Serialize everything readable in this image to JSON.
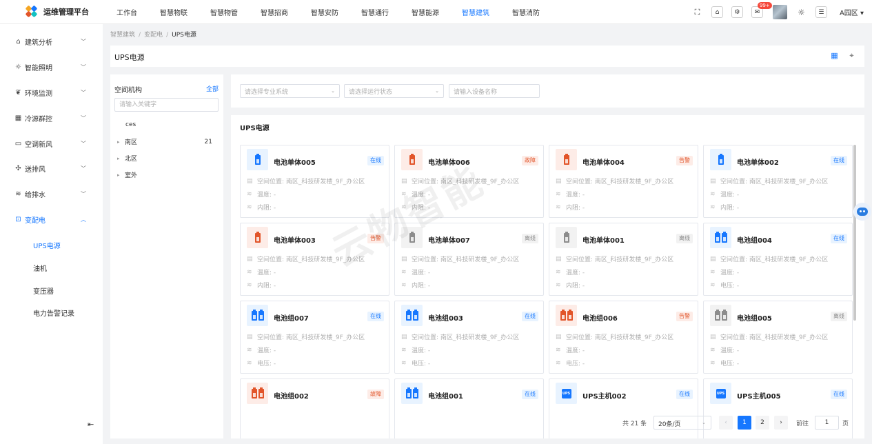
{
  "app": {
    "title": "运维管理平台"
  },
  "topnav": [
    {
      "label": "工作台",
      "active": false
    },
    {
      "label": "智慧物联",
      "active": false
    },
    {
      "label": "智慧物管",
      "active": false
    },
    {
      "label": "智慧招商",
      "active": false
    },
    {
      "label": "智慧安防",
      "active": false
    },
    {
      "label": "智慧通行",
      "active": false
    },
    {
      "label": "智慧能源",
      "active": false
    },
    {
      "label": "智慧建筑",
      "active": true
    },
    {
      "label": "智慧消防",
      "active": false
    }
  ],
  "topbar": {
    "badge": "99+",
    "user": "A园区"
  },
  "sidebar": {
    "items": [
      {
        "label": "建筑分析",
        "icon": "building-icon",
        "glyph": "⌂"
      },
      {
        "label": "智能照明",
        "icon": "lamp-icon",
        "glyph": "☼"
      },
      {
        "label": "环境监测",
        "icon": "leaf-icon",
        "glyph": "❦"
      },
      {
        "label": "冷源群控",
        "icon": "grid-icon",
        "glyph": "▦"
      },
      {
        "label": "空调新风",
        "icon": "aircon-icon",
        "glyph": "▭"
      },
      {
        "label": "送排风",
        "icon": "fan-icon",
        "glyph": "✣"
      },
      {
        "label": "给排水",
        "icon": "water-icon",
        "glyph": "≋"
      },
      {
        "label": "变配电",
        "icon": "power-icon",
        "glyph": "⊡",
        "open": true
      }
    ],
    "sub_items": [
      {
        "label": "UPS电源",
        "active": true
      },
      {
        "label": "油机",
        "active": false
      },
      {
        "label": "变压器",
        "active": false
      },
      {
        "label": "电力告警记录",
        "active": false
      }
    ]
  },
  "breadcrumb": [
    "智慧建筑",
    "变配电",
    "UPS电源"
  ],
  "page": {
    "title": "UPS电源"
  },
  "tree": {
    "title": "空间机构",
    "all_label": "全部",
    "search_placeholder": "请输入关键字",
    "nodes": [
      {
        "label": "ces",
        "count": "",
        "expandable": false
      },
      {
        "label": "南区",
        "count": "21",
        "expandable": true
      },
      {
        "label": "北区",
        "count": "",
        "expandable": true
      },
      {
        "label": "室外",
        "count": "",
        "expandable": true
      }
    ]
  },
  "filters": {
    "system_placeholder": "请选择专业系统",
    "status_placeholder": "请选择运行状态",
    "name_placeholder": "请输入设备名称"
  },
  "devices": {
    "title": "UPS电源",
    "cards": [
      {
        "name": "电池单体005",
        "status": "在线",
        "status_type": "online",
        "kind": "cell",
        "color": "#1677ff",
        "bg": "#e8f3ff",
        "location": "空间位置: 南区_科技研发楼_9F_办公区",
        "line2": "温度: -",
        "line3": "内阻: -"
      },
      {
        "name": "电池单体006",
        "status": "故障",
        "status_type": "fault",
        "kind": "cell",
        "color": "#e2552a",
        "bg": "#fdece7",
        "location": "空间位置: 南区_科技研发楼_9F_办公区",
        "line2": "温度: -",
        "line3": "内阻: -"
      },
      {
        "name": "电池单体004",
        "status": "告警",
        "status_type": "alarm",
        "kind": "cell",
        "color": "#e2552a",
        "bg": "#fdece7",
        "location": "空间位置: 南区_科技研发楼_9F_办公区",
        "line2": "温度: -",
        "line3": "内阻: -"
      },
      {
        "name": "电池单体002",
        "status": "在线",
        "status_type": "online",
        "kind": "cell",
        "color": "#1677ff",
        "bg": "#e8f3ff",
        "location": "空间位置: 南区_科技研发楼_9F_办公区",
        "line2": "温度: -",
        "line3": "内阻: -"
      },
      {
        "name": "电池单体003",
        "status": "告警",
        "status_type": "alarm",
        "kind": "cell",
        "color": "#e2552a",
        "bg": "#fdece7",
        "location": "空间位置: 南区_科技研发楼_9F_办公区",
        "line2": "温度: -",
        "line3": "内阻: -"
      },
      {
        "name": "电池单体007",
        "status": "离线",
        "status_type": "offline",
        "kind": "cell",
        "color": "#8c8c8c",
        "bg": "#f2f2f2",
        "location": "空间位置: 南区_科技研发楼_9F_办公区",
        "line2": "温度: -",
        "line3": "内阻: -"
      },
      {
        "name": "电池单体001",
        "status": "离线",
        "status_type": "offline",
        "kind": "cell",
        "color": "#8c8c8c",
        "bg": "#f2f2f2",
        "location": "空间位置: 南区_科技研发楼_9F_办公区",
        "line2": "温度: -",
        "line3": "内阻: -"
      },
      {
        "name": "电池组004",
        "status": "在线",
        "status_type": "online",
        "kind": "pack",
        "color": "#1677ff",
        "bg": "#e8f3ff",
        "location": "空间位置: 南区_科技研发楼_9F_办公区",
        "line2": "温度: -",
        "line3": "电压: -"
      },
      {
        "name": "电池组007",
        "status": "在线",
        "status_type": "online",
        "kind": "pack",
        "color": "#1677ff",
        "bg": "#e8f3ff",
        "location": "空间位置: 南区_科技研发楼_9F_办公区",
        "line2": "温度: -",
        "line3": "电压: -"
      },
      {
        "name": "电池组003",
        "status": "在线",
        "status_type": "online",
        "kind": "pack",
        "color": "#1677ff",
        "bg": "#e8f3ff",
        "location": "空间位置: 南区_科技研发楼_9F_办公区",
        "line2": "温度: -",
        "line3": "电压: -"
      },
      {
        "name": "电池组006",
        "status": "告警",
        "status_type": "alarm",
        "kind": "pack",
        "color": "#e2552a",
        "bg": "#fdece7",
        "location": "空间位置: 南区_科技研发楼_9F_办公区",
        "line2": "温度: -",
        "line3": "电压: -"
      },
      {
        "name": "电池组005",
        "status": "离线",
        "status_type": "offline",
        "kind": "pack",
        "color": "#8c8c8c",
        "bg": "#f2f2f2",
        "location": "空间位置: 南区_科技研发楼_9F_办公区",
        "line2": "温度: -",
        "line3": "电压: -"
      },
      {
        "name": "电池组002",
        "status": "故障",
        "status_type": "fault",
        "kind": "pack",
        "color": "#e2552a",
        "bg": "#fdece7",
        "location": "",
        "line2": "",
        "line3": ""
      },
      {
        "name": "电池组001",
        "status": "在线",
        "status_type": "online",
        "kind": "pack",
        "color": "#1677ff",
        "bg": "#e8f3ff",
        "location": "",
        "line2": "",
        "line3": ""
      },
      {
        "name": "UPS主机002",
        "status": "在线",
        "status_type": "online",
        "kind": "ups",
        "color": "#1677ff",
        "bg": "#e8f3ff",
        "location": "",
        "line2": "",
        "line3": ""
      },
      {
        "name": "UPS主机005",
        "status": "在线",
        "status_type": "online",
        "kind": "ups",
        "color": "#1677ff",
        "bg": "#e8f3ff",
        "location": "",
        "line2": "",
        "line3": ""
      }
    ]
  },
  "pagination": {
    "total": "共 21 条",
    "page_size": "20条/页",
    "prev": "‹",
    "next": "›",
    "pages": [
      "1",
      "2"
    ],
    "current": "1",
    "goto_label": "前往",
    "goto_value": "1",
    "page_unit": "页"
  },
  "watermark": "云物智能"
}
